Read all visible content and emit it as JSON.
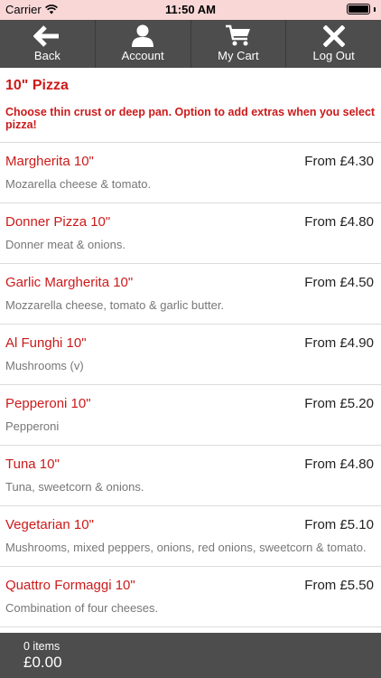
{
  "status_bar": {
    "carrier": "Carrier",
    "time": "11:50 AM"
  },
  "nav": {
    "back": "Back",
    "account": "Account",
    "cart": "My Cart",
    "logout": "Log Out"
  },
  "page": {
    "title": "10\" Pizza",
    "note": "Choose thin crust or deep pan. Option to add extras when you select pizza!"
  },
  "items": [
    {
      "name": "Margherita 10\"",
      "price": "From £4.30",
      "desc": "Mozarella cheese & tomato."
    },
    {
      "name": "Donner Pizza 10\"",
      "price": "From £4.80",
      "desc": "Donner meat & onions."
    },
    {
      "name": "Garlic Margherita 10\"",
      "price": "From £4.50",
      "desc": "Mozzarella cheese, tomato & garlic butter."
    },
    {
      "name": "Al Funghi 10\"",
      "price": "From £4.90",
      "desc": "Mushrooms (v)"
    },
    {
      "name": "Pepperoni 10\"",
      "price": "From £5.20",
      "desc": "Pepperoni"
    },
    {
      "name": "Tuna 10\"",
      "price": "From £4.80",
      "desc": "Tuna, sweetcorn & onions."
    },
    {
      "name": "Vegetarian 10\"",
      "price": "From £5.10",
      "desc": "Mushrooms, mixed peppers, onions, red onions, sweetcorn & tomato."
    },
    {
      "name": "Quattro Formaggi 10\"",
      "price": "From £5.50",
      "desc": "Combination of four cheeses."
    }
  ],
  "cart": {
    "count": "0 items",
    "total": "£0.00"
  },
  "colors": {
    "accent": "#cc1a1a",
    "nav_bg": "#4d4d4d",
    "status_bg": "#f9d7d7"
  }
}
